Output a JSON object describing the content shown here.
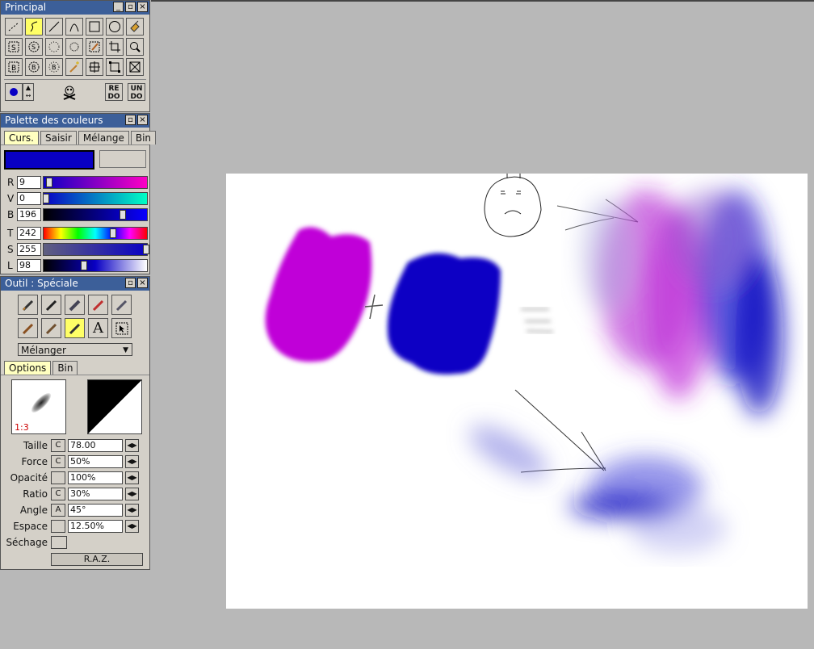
{
  "principal": {
    "title": "Principal",
    "tools": [
      "dotted-line",
      "freehand",
      "line",
      "curve",
      "rectangle",
      "ellipse",
      "bucket-fill",
      "select-s",
      "lasso-select",
      "select-poly",
      "select-dots",
      "brush-select",
      "crop",
      "zoom",
      "b-select",
      "b-select-2",
      "b-select-3",
      "magic-wand",
      "transform",
      "crop-frame",
      "fit"
    ],
    "redo": "RE DO",
    "undo": "UN DO"
  },
  "palette": {
    "title": "Palette des couleurs",
    "tabs": [
      "Curs.",
      "Saisir",
      "Mélange",
      "Bin"
    ],
    "color": "#0900c4",
    "sliders": [
      {
        "label": "R",
        "value": "9",
        "level": 0.035
      },
      {
        "label": "V",
        "value": "0",
        "level": 0.0
      },
      {
        "label": "B",
        "value": "196",
        "level": 0.77
      },
      {
        "label": "T",
        "value": "242",
        "level": 0.67
      },
      {
        "label": "S",
        "value": "255",
        "level": 1.0
      },
      {
        "label": "L",
        "value": "98",
        "level": 0.38
      }
    ]
  },
  "tool": {
    "title": "Outil : Spéciale",
    "mode": "Mélanger",
    "tabs": [
      "Options",
      "Bin"
    ],
    "ratio_preview": "1:3",
    "options": [
      {
        "label": "Taille",
        "flag": "C",
        "value": "78.00"
      },
      {
        "label": "Force",
        "flag": "C",
        "value": "50%"
      },
      {
        "label": "Opacité",
        "flag": "",
        "value": "100%"
      },
      {
        "label": "Ratio",
        "flag": "C",
        "value": "30%"
      },
      {
        "label": "Angle",
        "flag": "A",
        "value": "45°"
      },
      {
        "label": "Espace",
        "flag": "",
        "value": "12.50%"
      }
    ],
    "sechage": "Séchage",
    "reset": "R.A.Z."
  }
}
